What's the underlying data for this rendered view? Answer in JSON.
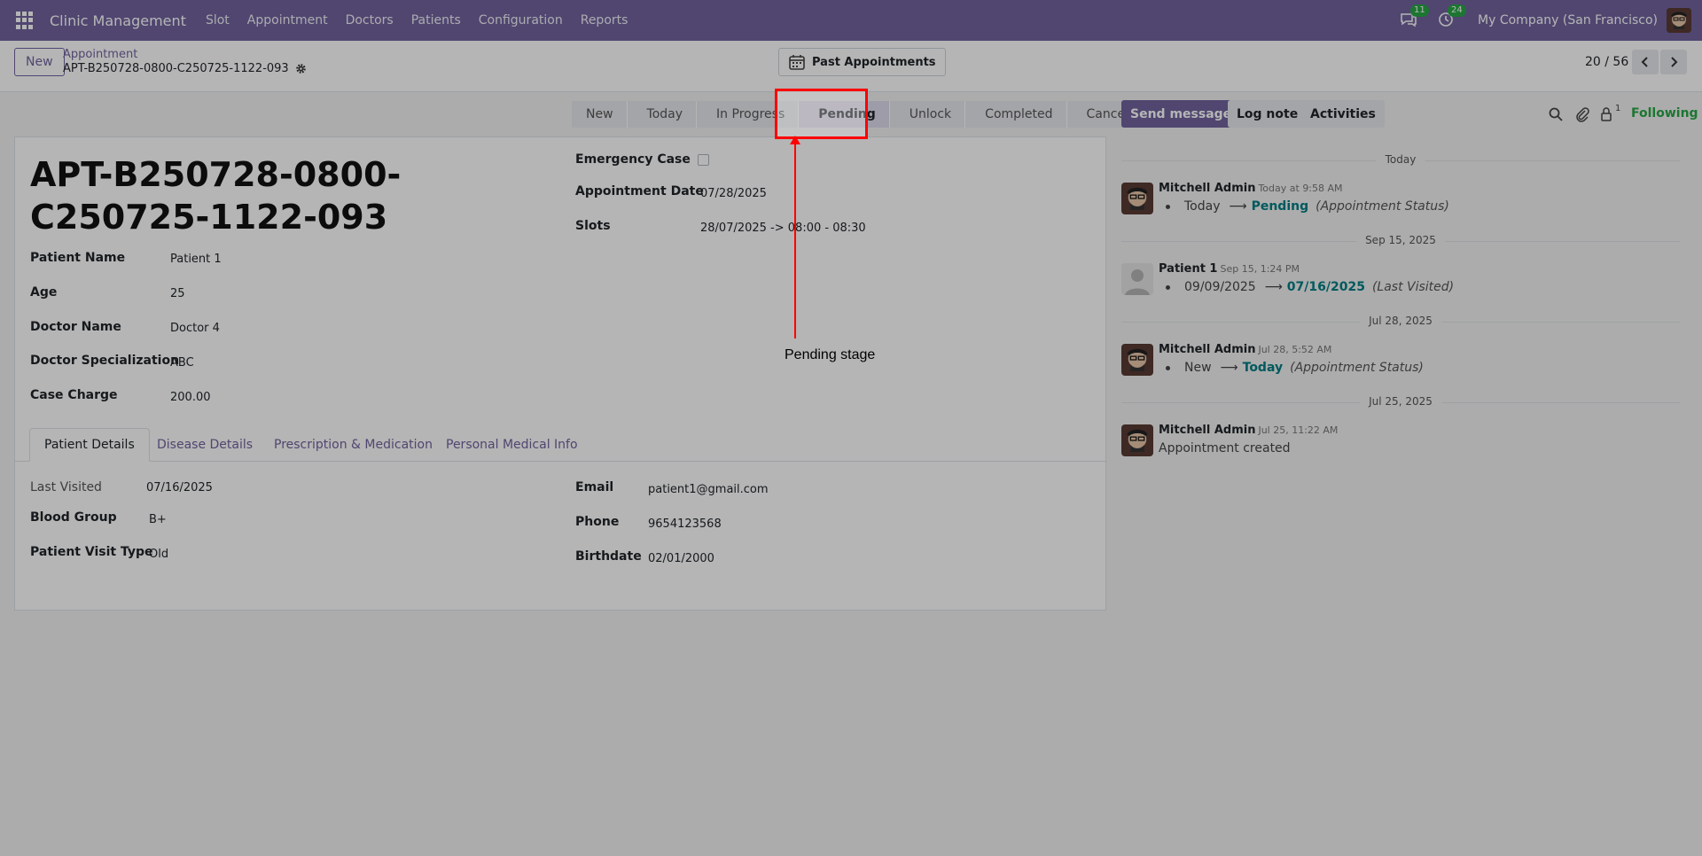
{
  "navbar": {
    "app_name": "Clinic Management",
    "menu": [
      "Slot",
      "Appointment",
      "Doctors",
      "Patients",
      "Configuration",
      "Reports"
    ],
    "messages_count": "11",
    "activities_count": "24",
    "company": "My Company (San Francisco)"
  },
  "control": {
    "new_label": "New",
    "breadcrumb_parent": "Appointment",
    "breadcrumb_current": "APT-B250728-0800-C250725-1122-093",
    "past_appointments_label": "Past Appointments",
    "pager": "20 / 56"
  },
  "statusbar": {
    "stages": [
      "New",
      "Today",
      "In Progress",
      "Pending",
      "Unlock",
      "Completed",
      "Cancelled"
    ],
    "active": "Pending"
  },
  "form": {
    "title": "APT-B250728-0800-C250725-1122-093",
    "left_fields": [
      {
        "label": "Patient Name",
        "value": "Patient 1"
      },
      {
        "label": "Age",
        "value": "25"
      },
      {
        "label": "Doctor Name",
        "value": "Doctor 4"
      },
      {
        "label": "Doctor Specialization",
        "value": "ABC"
      },
      {
        "label": "Case Charge",
        "value": "200.00"
      }
    ],
    "right_fields": {
      "emergency_label": "Emergency Case",
      "date_label": "Appointment Date",
      "date_value": "07/28/2025",
      "slots_label": "Slots",
      "slots_value": "28/07/2025 -> 08:00 - 08:30"
    },
    "tabs": [
      "Patient Details",
      "Disease Details",
      "Prescription & Medication",
      "Personal Medical Info"
    ],
    "patient_details": {
      "last_visited_label": "Last Visited",
      "last_visited_value": "07/16/2025",
      "blood_group_label": "Blood Group",
      "blood_group_value": "B+",
      "visit_type_label": "Patient Visit Type",
      "visit_type_value": "Old",
      "email_label": "Email",
      "email_value": "patient1@gmail.com",
      "phone_label": "Phone",
      "phone_value": "9654123568",
      "birthdate_label": "Birthdate",
      "birthdate_value": "02/01/2000"
    }
  },
  "chatter": {
    "send_message": "Send message",
    "log_note": "Log note",
    "activities": "Activities",
    "followers_count": "1",
    "following": "Following",
    "messages": [
      {
        "date": "Today",
        "author": "Mitchell Admin",
        "time": "Today at 9:58 AM",
        "old": "Today",
        "new": "Pending",
        "field": "(Appointment Status)"
      },
      {
        "date": "Sep 15, 2025",
        "author": "Patient 1",
        "time": "Sep 15, 1:24 PM",
        "old": "09/09/2025",
        "new": "07/16/2025",
        "field": "(Last Visited)"
      },
      {
        "date": "Jul 28, 2025",
        "author": "Mitchell Admin",
        "time": "Jul 28, 5:52 AM",
        "old": "New",
        "new": "Today",
        "field": "(Appointment Status)"
      },
      {
        "date": "Jul 25, 2025",
        "author": "Mitchell Admin",
        "time": "Jul 25, 11:22 AM",
        "text": "Appointment created"
      }
    ]
  },
  "annotation": {
    "label": "Pending stage"
  },
  "colors": {
    "brand": "#71639e",
    "highlight": "#ff0000",
    "following": "#28a745",
    "link_value": "#017e84"
  }
}
